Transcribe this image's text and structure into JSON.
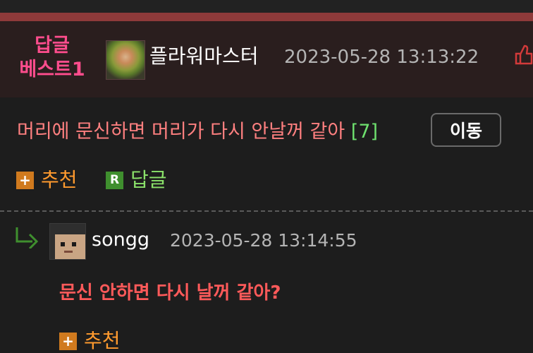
{
  "best_comment": {
    "badge_line1": "답글",
    "badge_line2": "베스트1",
    "author": "플라워마스터",
    "date": "2023-05-28 13:13:22",
    "text": "머리에 문신하면 머리가 다시 안날꺼 같아",
    "reply_count": "[7]",
    "move_label": "이동",
    "recommend_label": "추천",
    "reply_label": "답글",
    "reply_icon_letter": "R",
    "plus_icon": "+"
  },
  "reply": {
    "author": "songg",
    "date": "2023-05-28 13:14:55",
    "text": "문신 안하면 다시 날꺼 같아?",
    "recommend_label": "추천",
    "plus_icon": "+"
  },
  "colors": {
    "background": "#1d1d1d",
    "best_panel": "#2a1e1e",
    "accent_bar": "#8e3a3a",
    "badge": "#ff4d8d",
    "comment_text": "#ff8080",
    "reply_count": "#6ee06e",
    "recommend": "#ff9a2e",
    "reply_action": "#8be26a",
    "reply_text": "#ff5a5a"
  },
  "icons": {
    "thumb": "thumbs-up-icon",
    "plus": "plus-square-icon",
    "reply_badge": "r-square-icon",
    "reply_arrow": "reply-arrow-icon"
  }
}
